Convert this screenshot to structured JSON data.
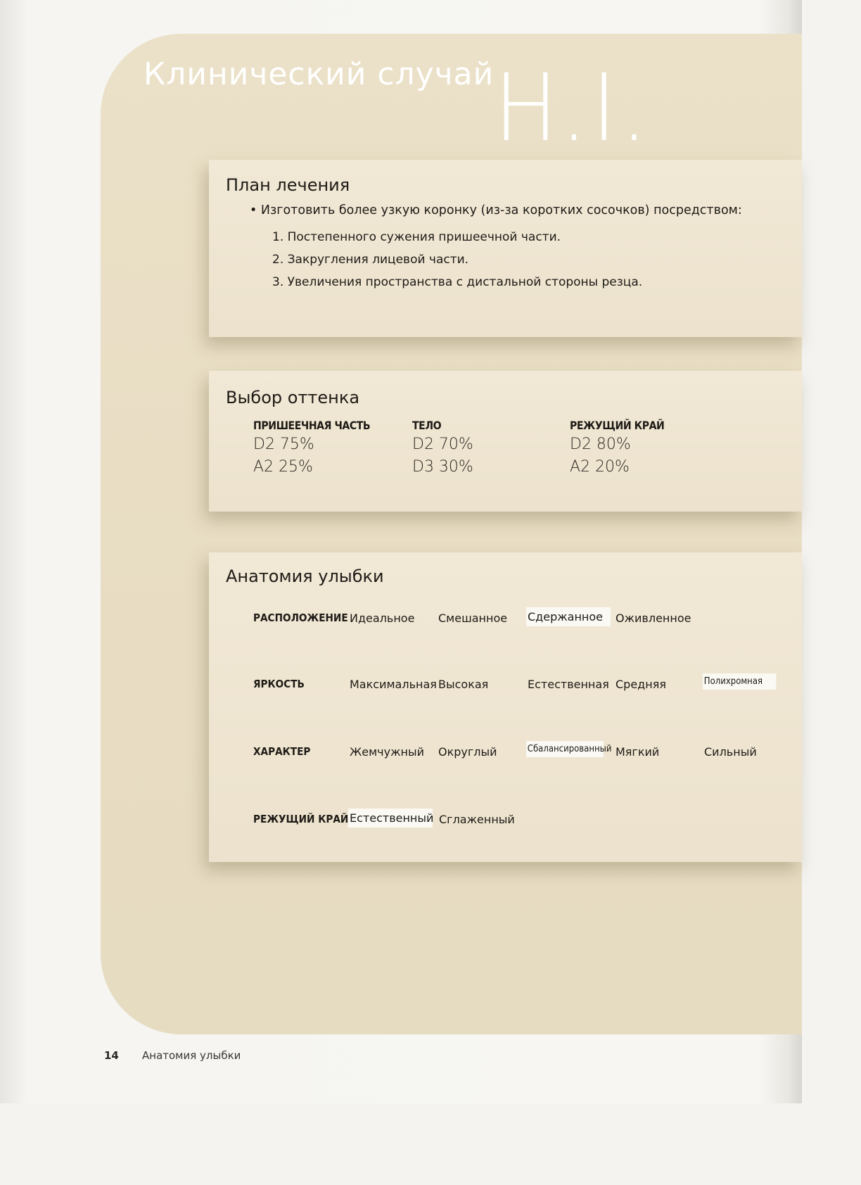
{
  "title": "Клинический случай",
  "title_big": "H.I.",
  "treatment_plan": {
    "heading": "План лечения",
    "bullet": "• Изготовить более узкую коронку (из-за коротких сосочков) посредством:",
    "items": [
      "1. Постепенного сужения пришеечной части.",
      "2. Закругления лицевой части.",
      "3. Увеличения пространства с дистальной стороны резца."
    ]
  },
  "shade": {
    "heading": "Выбор оттенка",
    "columns": [
      {
        "header": "ПРИШЕЕЧНАЯ ЧАСТЬ",
        "values": [
          "D2 75%",
          "A2 25%"
        ]
      },
      {
        "header": "ТЕЛО",
        "values": [
          "D2 70%",
          "D3 30%"
        ]
      },
      {
        "header": "РЕЖУЩИЙ КРАЙ",
        "values": [
          "D2 80%",
          "A2 20%"
        ]
      }
    ]
  },
  "smile": {
    "heading": "Анатомия улыбки",
    "rows": [
      {
        "label": "РАСПОЛОЖЕНИЕ",
        "options": [
          "Идеальное",
          "Смешанное",
          "Сдержанное",
          "Оживленное"
        ],
        "selected": 2
      },
      {
        "label": "ЯРКОСТЬ",
        "options": [
          "Максимальная",
          "Высокая",
          "Естественная",
          "Средняя",
          "Полихромная"
        ],
        "selected": 4
      },
      {
        "label": "ХАРАКТЕР",
        "options": [
          "Жемчужный",
          "Округлый",
          "Сбалансированный",
          "Мягкий",
          "Сильный"
        ],
        "selected": 2
      },
      {
        "label": "РЕЖУЩИЙ КРАЙ",
        "options": [
          "Естественный",
          "Сглаженный"
        ],
        "selected": 0
      }
    ]
  },
  "footer": {
    "page_number": "14",
    "text": "Анатомия улыбки"
  }
}
